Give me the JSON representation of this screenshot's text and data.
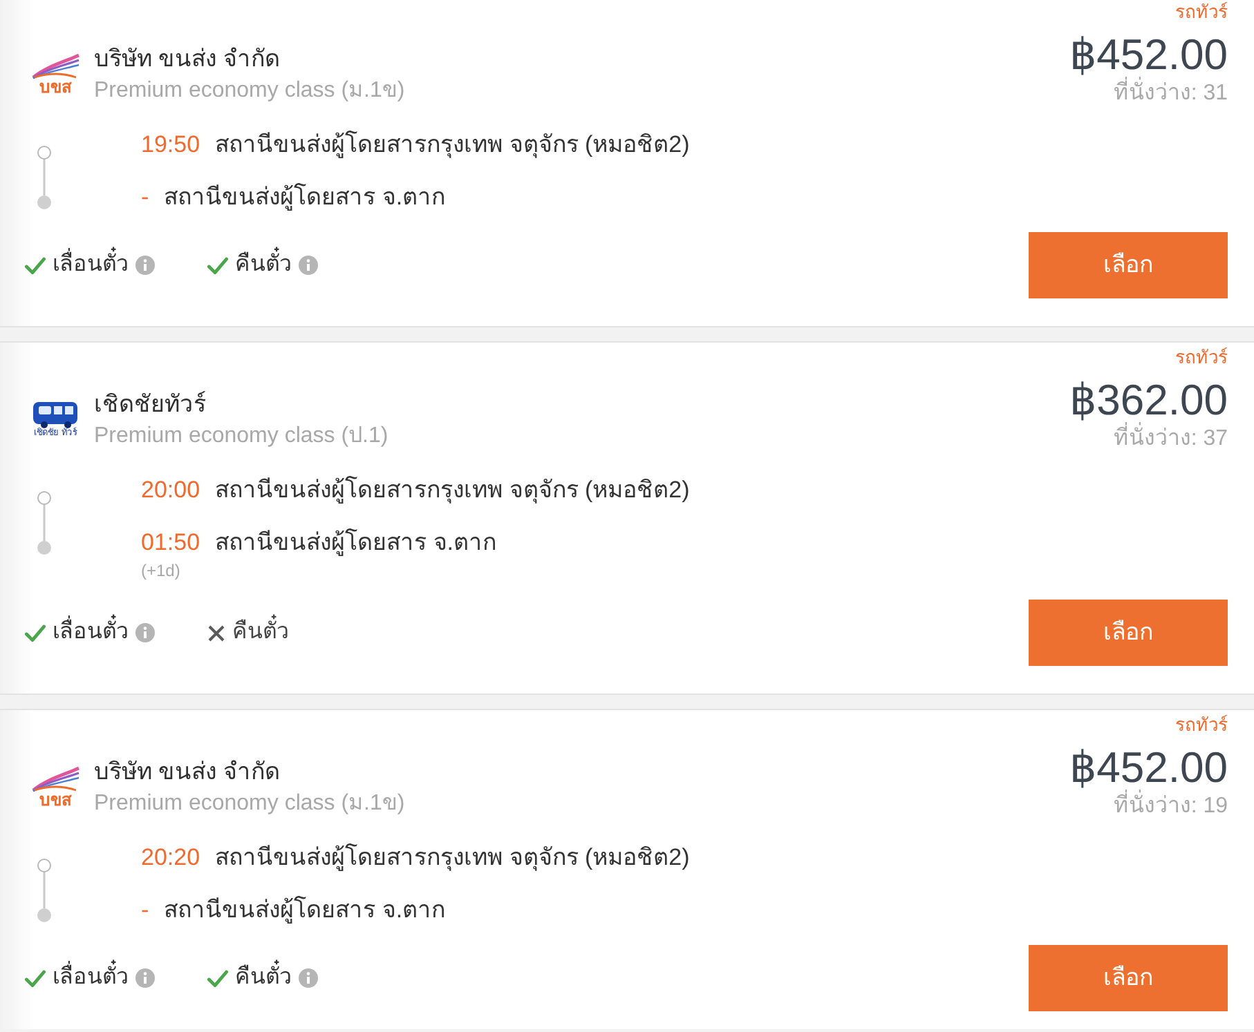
{
  "trips": [
    {
      "vehicle_type": "รถทัวร์",
      "logo": {
        "kind": "swoosh",
        "text": "บขส"
      },
      "operator": "บริษัท ขนส่ง จำกัด",
      "seat_class": "Premium economy class (ม.1ข)",
      "price": "฿452.00",
      "seats_left": "ที่นั่งว่าง: 31",
      "stops": [
        {
          "time": "19:50",
          "station": "สถานีขนส่งผู้โดยสารกรุงเทพ จตุจักร (หมอชิต2)"
        },
        {
          "time": "-",
          "station": "สถานีขนส่งผู้โดยสาร จ.ตาก"
        }
      ],
      "features": [
        {
          "label": "เลื่อนตั๋ว",
          "available": true,
          "info": true
        },
        {
          "label": "คืนตั๋ว",
          "available": true,
          "info": true
        }
      ],
      "button": "เลือก"
    },
    {
      "vehicle_type": "รถทัวร์",
      "logo": {
        "kind": "bus",
        "text": "เชิดชัย ทัวร์"
      },
      "operator": "เชิดชัยทัวร์",
      "seat_class": "Premium economy class (ป.1)",
      "price": "฿362.00",
      "seats_left": "ที่นั่งว่าง: 37",
      "stops": [
        {
          "time": "20:00",
          "station": "สถานีขนส่งผู้โดยสารกรุงเทพ จตุจักร (หมอชิต2)"
        },
        {
          "time": "01:50",
          "station": "สถานีขนส่งผู้โดยสาร จ.ตาก",
          "day_offset": "(+1d)"
        }
      ],
      "features": [
        {
          "label": "เลื่อนตั๋ว",
          "available": true,
          "info": true
        },
        {
          "label": "คืนตั๋ว",
          "available": false,
          "info": false
        }
      ],
      "button": "เลือก"
    },
    {
      "vehicle_type": "รถทัวร์",
      "logo": {
        "kind": "swoosh",
        "text": "บขส"
      },
      "operator": "บริษัท ขนส่ง จำกัด",
      "seat_class": "Premium economy class (ม.1ข)",
      "price": "฿452.00",
      "seats_left": "ที่นั่งว่าง: 19",
      "stops": [
        {
          "time": "20:20",
          "station": "สถานีขนส่งผู้โดยสารกรุงเทพ จตุจักร (หมอชิต2)"
        },
        {
          "time": "-",
          "station": "สถานีขนส่งผู้โดยสาร จ.ตาก"
        }
      ],
      "features": [
        {
          "label": "เลื่อนตั๋ว",
          "available": true,
          "info": true
        },
        {
          "label": "คืนตั๋ว",
          "available": true,
          "info": true
        }
      ],
      "button": "เลือก"
    }
  ]
}
